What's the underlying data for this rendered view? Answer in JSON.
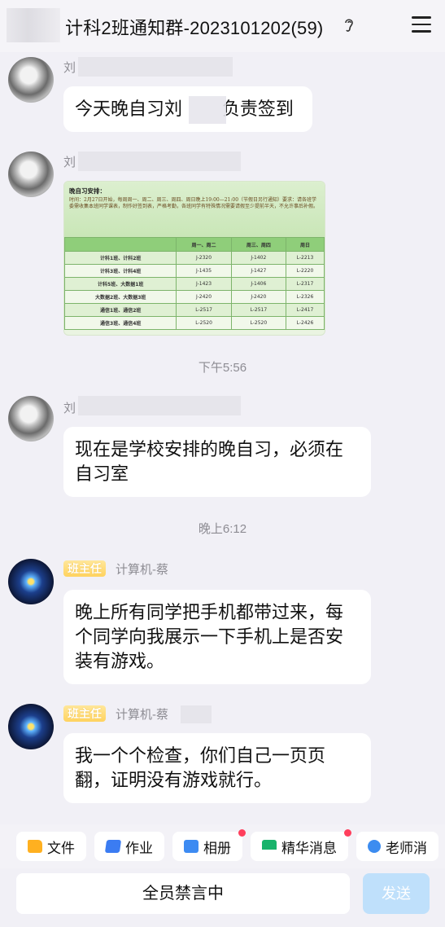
{
  "header": {
    "title": "计科2班通知群-2023101202(59)",
    "ear_icon": "ear-icon",
    "menu_icon": "hamburger-menu-icon"
  },
  "messages": [
    {
      "sender": "刘",
      "text": "今天晚自习刘        负责签到"
    },
    {
      "sender": "刘",
      "type": "image"
    },
    {
      "sender": "刘",
      "text": "现在是学校安排的晚自习，必须在自习室"
    },
    {
      "badge": "班主任",
      "sender": "计算机-蔡",
      "text": "晚上所有同学把手机都带过来，每个同学向我展示一下手机上是否安装有游戏。"
    },
    {
      "badge": "班主任",
      "sender": "计算机-蔡",
      "text": "我一个个检查，你们自己一页页翻，证明没有游戏就行。"
    }
  ],
  "times": [
    "下午5:56",
    "晚上6:12"
  ],
  "schedule_image": {
    "title": "晚自习安排：",
    "note": "时间：2月27日开始，每周周一、周二、周三、周四、周日晚上19:00—21:00（节假日另行通知）要求：请各班学委需收集本班同学课表，制作好签到表，严格考勤，各班同学有特殊情况需要请假至少提前半天，不允许事后补假。",
    "headers": [
      "",
      "周一、周二",
      "周三、周四",
      "周日"
    ],
    "rows": [
      [
        "计科1班、计科2班",
        "J-2320",
        "J-1402",
        "L-2213"
      ],
      [
        "计科3班、计科4班",
        "J-1435",
        "J-1427",
        "L-2220"
      ],
      [
        "计科5班、大数据1班",
        "J-1423",
        "J-1406",
        "L-2317"
      ],
      [
        "大数据2班、大数据3班",
        "J-2420",
        "J-2420",
        "L-2326"
      ],
      [
        "通信1班、通信2班",
        "L-2517",
        "L-2517",
        "L-2417"
      ],
      [
        "通信3班、通信4班",
        "L-2520",
        "L-2520",
        "L-2426"
      ]
    ]
  },
  "toolbar": [
    {
      "label": "文件",
      "icon": "folder-icon",
      "dot": false
    },
    {
      "label": "作业",
      "icon": "homework-icon",
      "dot": false
    },
    {
      "label": "相册",
      "icon": "album-icon",
      "dot": true
    },
    {
      "label": "精华消息",
      "icon": "essence-icon",
      "dot": true
    },
    {
      "label": "老师消",
      "icon": "teacher-icon",
      "dot": false
    }
  ],
  "input": {
    "muted_text": "全员禁言中",
    "send_label": "发送"
  },
  "colors": {
    "background": "#f1f0f6",
    "send_button": "#bfe0fb",
    "badge": "#ffd35e",
    "notification_dot": "#ff3e5c"
  }
}
